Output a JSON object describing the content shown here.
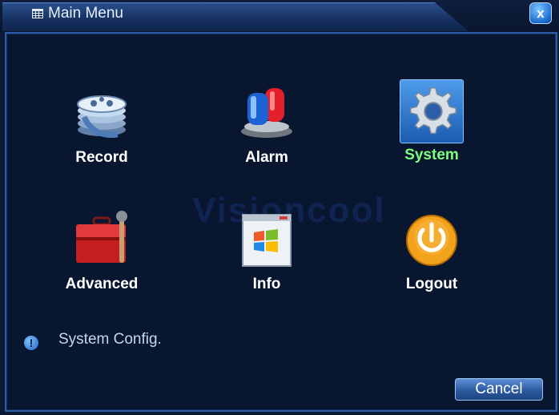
{
  "window": {
    "title": "Main Menu",
    "close_label": "x"
  },
  "menu": {
    "items": [
      {
        "label": "Record",
        "icon": "film-reel-icon",
        "selected": false
      },
      {
        "label": "Alarm",
        "icon": "siren-icon",
        "selected": false
      },
      {
        "label": "System",
        "icon": "gear-icon",
        "selected": true
      },
      {
        "label": "Advanced",
        "icon": "toolbox-icon",
        "selected": false
      },
      {
        "label": "Info",
        "icon": "windows-info-icon",
        "selected": false
      },
      {
        "label": "Logout",
        "icon": "power-icon",
        "selected": false
      }
    ]
  },
  "watermark": "Visioncool",
  "status": {
    "icon": "info-icon",
    "text": "System Config."
  },
  "footer": {
    "cancel_label": "Cancel"
  },
  "colors": {
    "selected_label": "#7dff7d",
    "accent": "#2f5da5",
    "background": "#091630"
  }
}
